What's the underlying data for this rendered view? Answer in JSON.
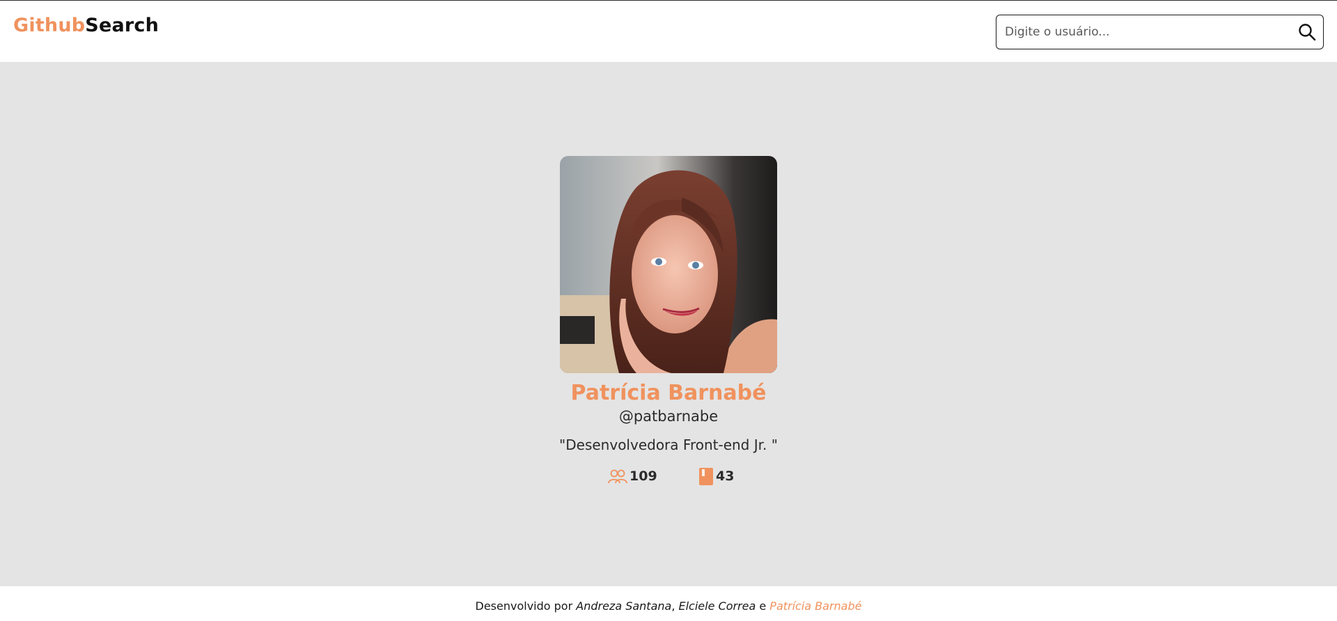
{
  "header": {
    "logo_accent": "Github",
    "logo_rest": "Search"
  },
  "search": {
    "placeholder": "Digite o usuário...",
    "value": "",
    "icon": "search-icon"
  },
  "profile": {
    "name": "Patrícia Barnabé",
    "login": "@patbarnabe",
    "bio": "\"Desenvolvedora Front-end Jr. \"",
    "followers": "109",
    "followers_icon": "people-icon",
    "repositories": "43",
    "repositories_icon": "book-icon"
  },
  "footer": {
    "prefix": "Desenvolvido por ",
    "author1": "Andreza Santana",
    "sep1": ", ",
    "author2": "Elciele Correa",
    "sep2": " e ",
    "author3": "Patrícia Barnabé"
  },
  "colors": {
    "accent": "#f0925e",
    "background": "#e4e4e4",
    "bar": "#ffffff",
    "text": "#2b2b2b"
  }
}
